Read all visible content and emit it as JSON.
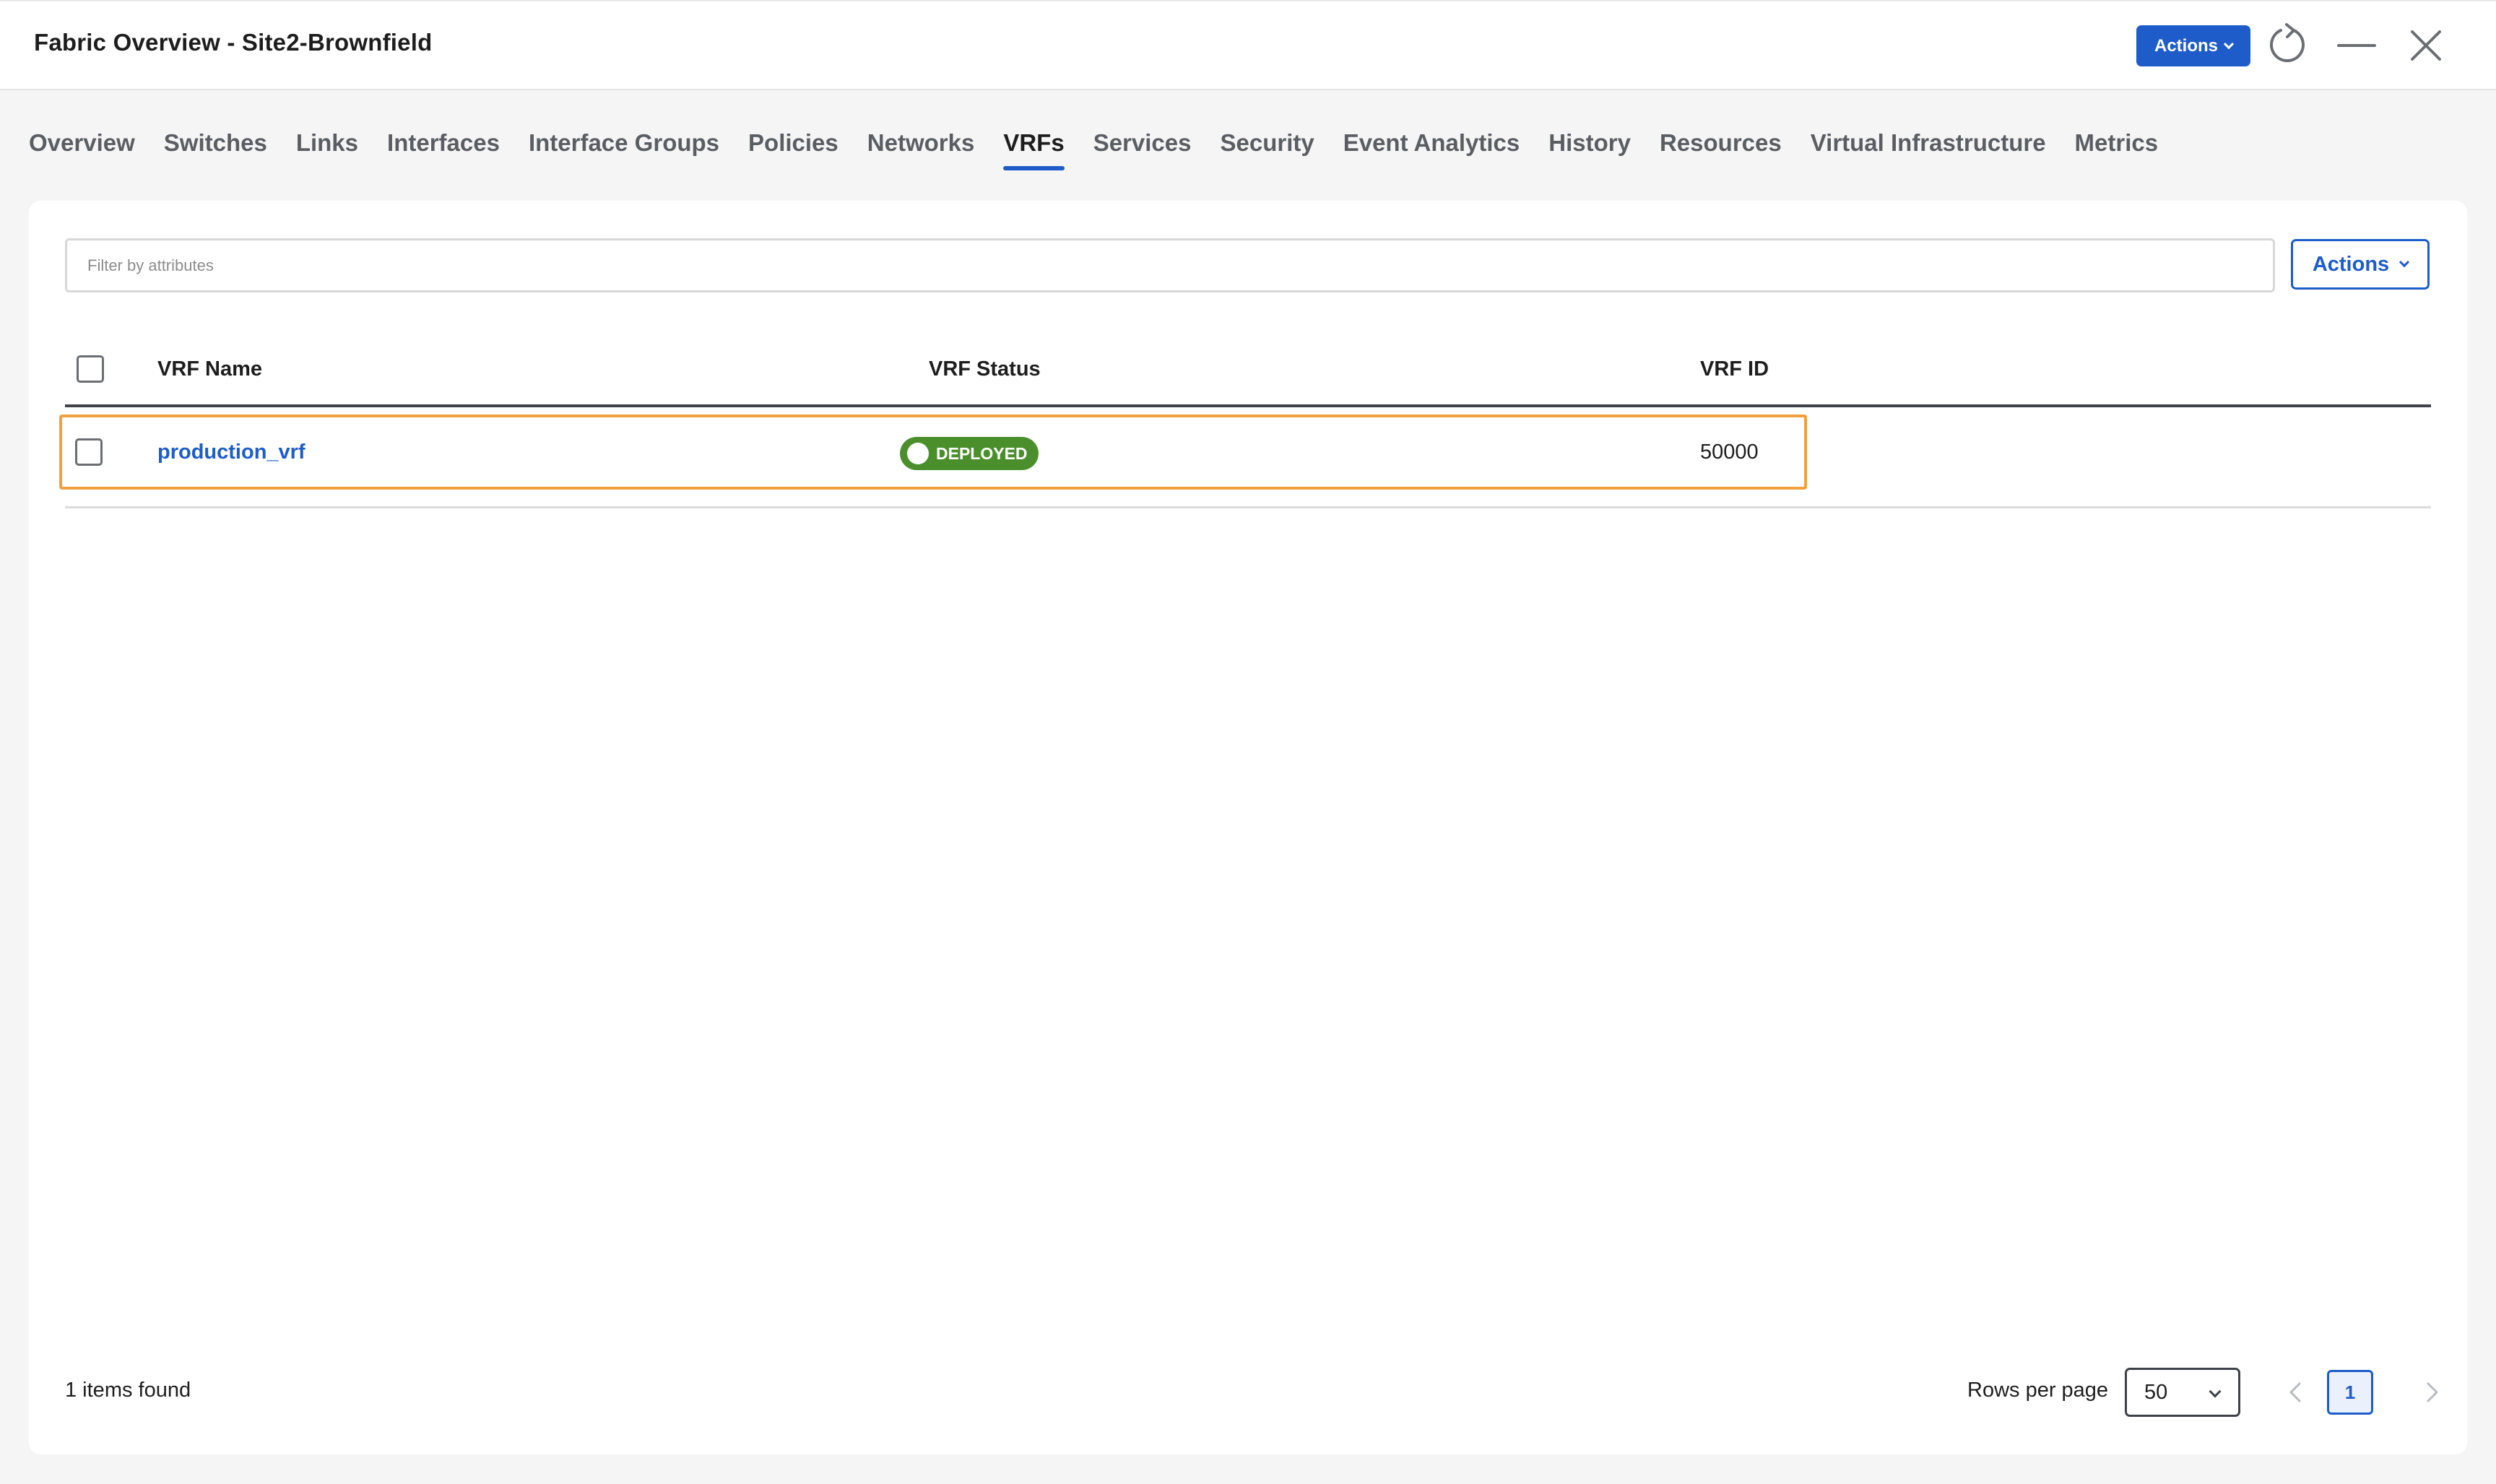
{
  "header": {
    "title": "Fabric Overview - Site2-Brownfield",
    "actions_label": "Actions"
  },
  "tabs": [
    {
      "label": "Overview",
      "active": false
    },
    {
      "label": "Switches",
      "active": false
    },
    {
      "label": "Links",
      "active": false
    },
    {
      "label": "Interfaces",
      "active": false
    },
    {
      "label": "Interface Groups",
      "active": false
    },
    {
      "label": "Policies",
      "active": false
    },
    {
      "label": "Networks",
      "active": false
    },
    {
      "label": "VRFs",
      "active": true
    },
    {
      "label": "Services",
      "active": false
    },
    {
      "label": "Security",
      "active": false
    },
    {
      "label": "Event Analytics",
      "active": false
    },
    {
      "label": "History",
      "active": false
    },
    {
      "label": "Resources",
      "active": false
    },
    {
      "label": "Virtual Infrastructure",
      "active": false
    },
    {
      "label": "Metrics",
      "active": false
    }
  ],
  "filter": {
    "placeholder": "Filter by attributes",
    "value": ""
  },
  "panel_actions_label": "Actions",
  "table": {
    "columns": [
      "VRF Name",
      "VRF Status",
      "VRF ID"
    ],
    "rows": [
      {
        "name": "production_vrf",
        "status": "DEPLOYED",
        "id": "50000",
        "highlighted": true
      }
    ]
  },
  "footer": {
    "items_found": "1 items found",
    "rows_per_page_label": "Rows per page",
    "rows_per_page_value": "50",
    "current_page": "1"
  },
  "colors": {
    "primary": "#1d5cc9",
    "deployed": "#4b8f2c",
    "highlight": "#f0a03c"
  }
}
